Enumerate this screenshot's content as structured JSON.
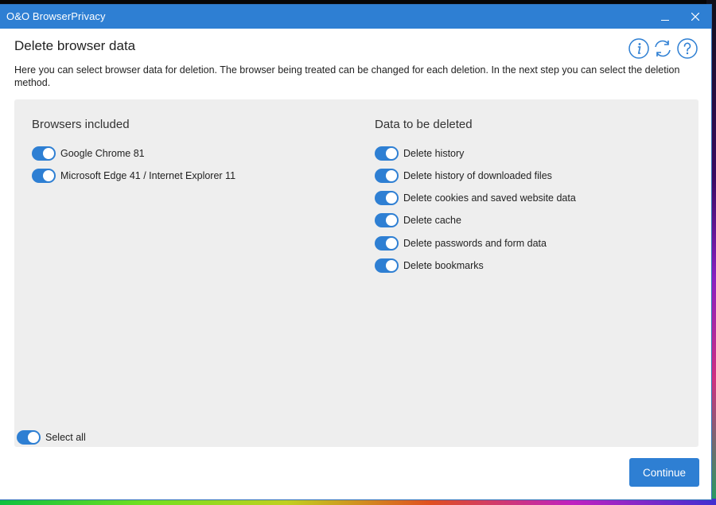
{
  "window": {
    "title": "O&O BrowserPrivacy",
    "minimize_icon": "minimize-icon",
    "close_icon": "close-icon"
  },
  "header": {
    "title": "Delete browser data",
    "description": "Here you can select browser data for deletion. The browser being treated can be changed for each deletion. In the next step you can select the deletion method.",
    "icons": [
      "info-icon",
      "refresh-icon",
      "help-icon"
    ]
  },
  "browsers": {
    "title": "Browsers included",
    "items": [
      {
        "label": "Google Chrome 81",
        "on": true
      },
      {
        "label": "Microsoft Edge 41 / Internet Explorer 11",
        "on": true
      }
    ]
  },
  "data_to_delete": {
    "title": "Data to be deleted",
    "items": [
      {
        "label": "Delete history",
        "on": true
      },
      {
        "label": "Delete history of downloaded files",
        "on": true
      },
      {
        "label": "Delete cookies and saved website data",
        "on": true
      },
      {
        "label": "Delete cache",
        "on": true
      },
      {
        "label": "Delete passwords and form data",
        "on": true
      },
      {
        "label": "Delete bookmarks",
        "on": true
      }
    ]
  },
  "select_all": {
    "label": "Select all",
    "on": true
  },
  "continue_label": "Continue",
  "colors": {
    "accent": "#2e7fd3",
    "panel": "#eeeeee"
  }
}
